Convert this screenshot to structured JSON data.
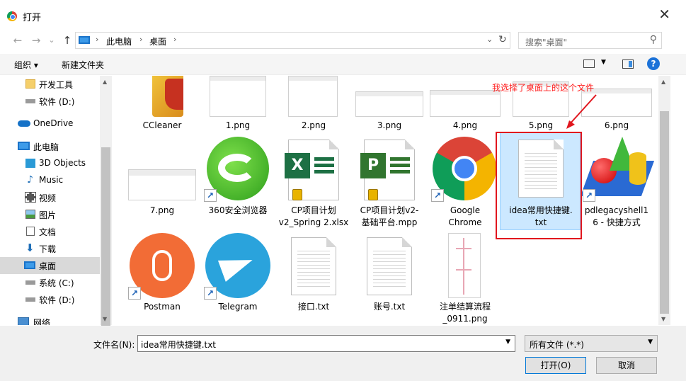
{
  "window": {
    "title": "打开",
    "close_glyph": "✕",
    "app_icon": "chrome-icon"
  },
  "nav": {
    "back_glyph": "←",
    "forward_glyph": "→",
    "dropdown_glyph": "⌄",
    "up_glyph": "↑",
    "breadcrumbs": [
      "此电脑",
      "桌面"
    ],
    "search_placeholder": "搜索\"桌面\"",
    "refresh_glyph": "↻",
    "search_glyph": "⚲"
  },
  "toolbar": {
    "organize": "组织 ▾",
    "new_folder": "新建文件夹",
    "help": "?"
  },
  "sidebar": {
    "items": [
      {
        "label": "开发工具",
        "icon": "folder-icon"
      },
      {
        "label": "软件 (D:)",
        "icon": "drive-icon"
      },
      {
        "label": "OneDrive",
        "icon": "cloud-icon"
      },
      {
        "label": "此电脑",
        "icon": "computer-icon"
      },
      {
        "label": "3D Objects",
        "icon": "3d-objects-icon"
      },
      {
        "label": "Music",
        "icon": "music-icon"
      },
      {
        "label": "视频",
        "icon": "video-icon"
      },
      {
        "label": "图片",
        "icon": "picture-icon"
      },
      {
        "label": "文档",
        "icon": "document-icon"
      },
      {
        "label": "下载",
        "icon": "download-icon"
      },
      {
        "label": "桌面",
        "icon": "desktop-icon",
        "selected": true
      },
      {
        "label": "系统 (C:)",
        "icon": "drive-icon"
      },
      {
        "label": "软件 (D:)",
        "icon": "drive-icon"
      },
      {
        "label": "网络",
        "icon": "network-icon"
      }
    ]
  },
  "files": {
    "row1": [
      "CCleaner",
      "1.png",
      "2.png",
      "3.png",
      "4.png",
      "5.png",
      "6.png"
    ],
    "row2": [
      "7.png",
      "360安全浏览器",
      "CP项目计划\nv2_Spring 2.xlsx",
      "CP项目计划v2-\n基础平台.mpp",
      "Google\nChrome",
      "idea常用快捷键.\ntxt",
      "pdlegacyshell1\n6 - 快捷方式"
    ],
    "row3": [
      "Postman",
      "Telegram",
      "接口.txt",
      "账号.txt",
      "注单结算流程\n_0911.png"
    ]
  },
  "annotation": {
    "text": "我选择了桌面上的这个文件",
    "color": "#ff1f1f"
  },
  "footer": {
    "filename_label": "文件名(N):",
    "filename_value": "idea常用快捷键.txt",
    "filter_value": "所有文件 (*.*)",
    "open_button": "打开(O)",
    "cancel_button": "取消"
  },
  "colors": {
    "selection": "#cce8ff",
    "accent": "#0078d7"
  }
}
